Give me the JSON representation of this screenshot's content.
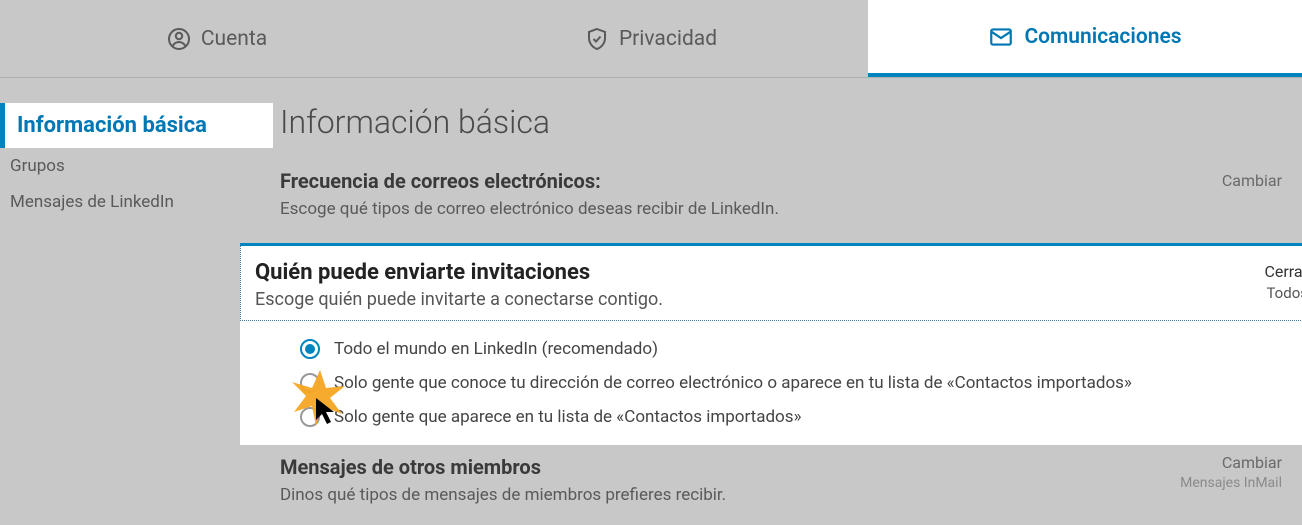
{
  "tabs": {
    "account": "Cuenta",
    "privacy": "Privacidad",
    "communications": "Comunicaciones"
  },
  "sidebar": {
    "items": [
      {
        "label": "Información básica"
      },
      {
        "label": "Grupos"
      },
      {
        "label": "Mensajes de LinkedIn"
      }
    ]
  },
  "main": {
    "title": "Información básica",
    "sections": {
      "email_freq": {
        "title": "Frecuencia de correos electrónicos:",
        "desc": "Escoge qué tipos de correo electrónico deseas recibir de LinkedIn.",
        "action": "Cambiar"
      },
      "invitations": {
        "title": "Quién puede enviarte invitaciones",
        "desc": "Escoge quién puede invitarte a conectarse contigo.",
        "close": "Cerrar",
        "all": "Todos",
        "options": [
          "Todo el mundo en LinkedIn (recomendado)",
          "Solo gente que conoce tu dirección de correo electrónico o aparece en tu lista de «Contactos importados»",
          "Solo gente que aparece en tu lista de «Contactos importados»"
        ]
      },
      "member_msgs": {
        "title": "Mensajes de otros miembros",
        "desc": "Dinos qué tipos de mensajes de miembros prefieres recibir.",
        "action": "Cambiar",
        "sub": "Mensajes InMail"
      }
    }
  }
}
